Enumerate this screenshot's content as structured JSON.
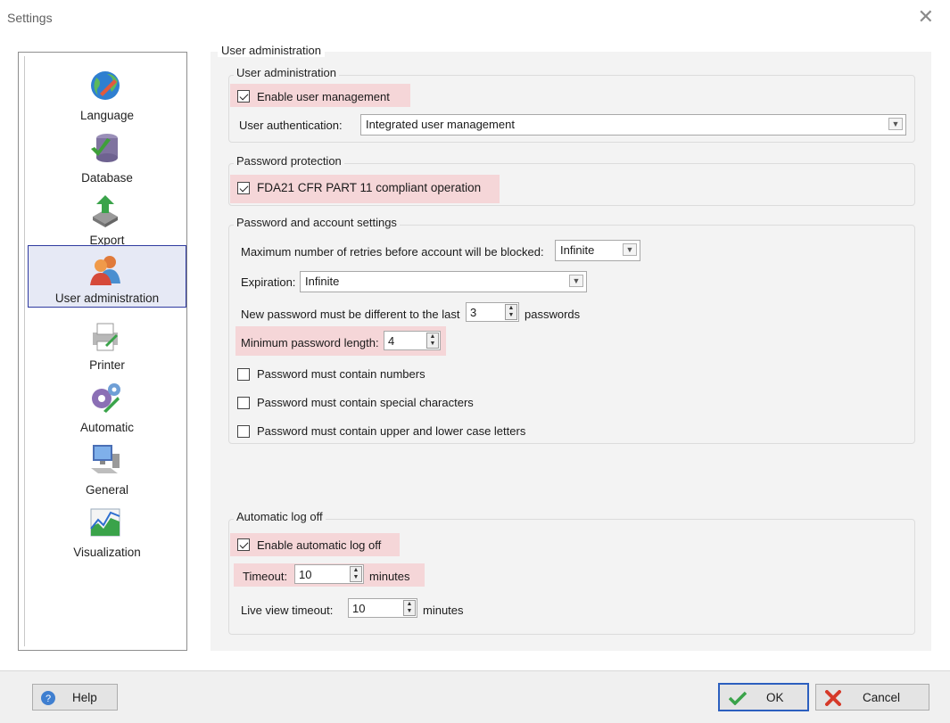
{
  "window": {
    "title": "Settings",
    "close_glyph": "✕"
  },
  "sidebar": {
    "items": [
      {
        "label": "Language",
        "icon": "globe-icon"
      },
      {
        "label": "Database",
        "icon": "database-icon"
      },
      {
        "label": "Export",
        "icon": "export-icon"
      },
      {
        "label": "User administration",
        "icon": "users-icon",
        "active": true
      },
      {
        "label": "Printer",
        "icon": "printer-icon"
      },
      {
        "label": "Automatic",
        "icon": "gears-icon"
      },
      {
        "label": "General",
        "icon": "computer-icon"
      },
      {
        "label": "Visualization",
        "icon": "chart-icon"
      }
    ]
  },
  "main": {
    "outer_title": "User administration",
    "user_admin": {
      "title": "User administration",
      "enable_user_management": {
        "label": "Enable user management",
        "checked": true
      },
      "auth_label": "User authentication:",
      "auth_value": "Integrated user management"
    },
    "password_protection": {
      "title": "Password protection",
      "fda": {
        "label": "FDA21 CFR PART 11 compliant operation",
        "checked": true
      }
    },
    "account_settings": {
      "title": "Password and account settings",
      "retries_label": "Maximum number of retries before account will be blocked:",
      "retries_value": "Infinite",
      "expiration_label": "Expiration:",
      "expiration_value": "Infinite",
      "different_label": "New password must be different to the last",
      "different_value": "3",
      "different_suffix": "passwords",
      "min_length_label": "Minimum password length:",
      "min_length_value": "4",
      "numbers": {
        "label": "Password must contain numbers",
        "checked": false
      },
      "special": {
        "label": "Password must contain special characters",
        "checked": false
      },
      "case": {
        "label": "Password must contain upper and lower case letters",
        "checked": false
      }
    },
    "auto_logoff": {
      "title": "Automatic log off",
      "enable": {
        "label": "Enable automatic log off",
        "checked": true
      },
      "timeout_label": "Timeout:",
      "timeout_value": "10",
      "timeout_unit": "minutes",
      "live_label": "Live view timeout:",
      "live_value": "10",
      "live_unit": "minutes"
    }
  },
  "footer": {
    "help_label": "Help",
    "ok_label": "OK",
    "cancel_label": "Cancel"
  },
  "colors": {
    "highlight": "#f5d6d8",
    "panel": "#f3f3f3",
    "active_border": "#2f3aa0"
  }
}
